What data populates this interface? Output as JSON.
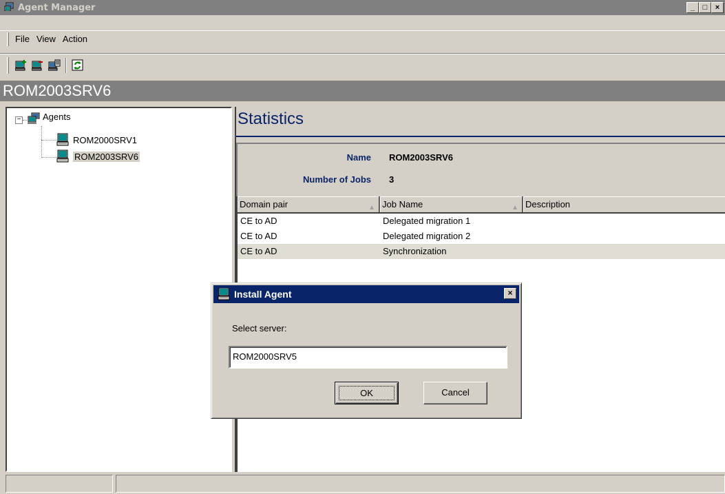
{
  "window": {
    "title": "Agent Manager",
    "controls": {
      "minimize": "_",
      "maximize": "□",
      "close": "×"
    }
  },
  "menu": [
    {
      "label": "File",
      "mnemonic": "F"
    },
    {
      "label": "View",
      "mnemonic": "V"
    },
    {
      "label": "Action",
      "mnemonic": "A"
    }
  ],
  "toolbar": {
    "icons": [
      "install-agent-icon",
      "remove-agent-icon",
      "properties-icon",
      "refresh-icon"
    ]
  },
  "header": {
    "server": "ROM2003SRV6"
  },
  "tree": {
    "root": {
      "label": "Agents",
      "expander": "−"
    },
    "children": [
      {
        "label": "ROM2000SRV1",
        "selected": false
      },
      {
        "label": "ROM2003SRV6",
        "selected": true
      }
    ]
  },
  "statistics": {
    "title": "Statistics",
    "name_label": "Name",
    "name_value": "ROM2003SRV6",
    "jobs_label": "Number of Jobs",
    "jobs_value": "3"
  },
  "jobs_table": {
    "columns": [
      "Domain pair",
      "Job Name",
      "Description"
    ],
    "rows": [
      {
        "domain_pair": "CE to AD",
        "job_name": "Delegated migration 1",
        "description": ""
      },
      {
        "domain_pair": "CE to AD",
        "job_name": "Delegated migration 2",
        "description": ""
      },
      {
        "domain_pair": "CE to AD",
        "job_name": "Synchronization",
        "description": ""
      }
    ]
  },
  "dialog": {
    "title": "Install Agent",
    "prompt": "Select server:",
    "input_value": "ROM2000SRV5",
    "ok_label": "OK",
    "cancel_label": "Cancel"
  },
  "colors": {
    "face": "#d4d0c8",
    "titlebar_inactive": "#808080",
    "dialog_title_active": "#0a246a",
    "accent_text": "#0a246a"
  }
}
